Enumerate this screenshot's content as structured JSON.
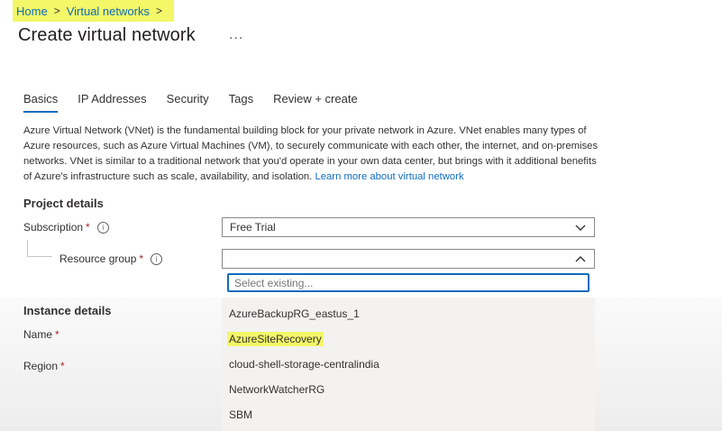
{
  "breadcrumb": {
    "home": "Home",
    "virtual_networks": "Virtual networks",
    "sep": ">"
  },
  "page": {
    "title": "Create virtual network",
    "more": "..."
  },
  "tabs": [
    {
      "label": "Basics",
      "active": true
    },
    {
      "label": "IP Addresses",
      "active": false
    },
    {
      "label": "Security",
      "active": false
    },
    {
      "label": "Tags",
      "active": false
    },
    {
      "label": "Review + create",
      "active": false
    }
  ],
  "intro": {
    "text": "Azure Virtual Network (VNet) is the fundamental building block for your private network in Azure. VNet enables many types of Azure resources, such as Azure Virtual Machines (VM), to securely communicate with each other, the internet, and on-premises networks. VNet is similar to a traditional network that you'd operate in your own data center, but brings with it additional benefits of Azure's infrastructure such as scale, availability, and isolation.",
    "link": "Learn more about virtual network"
  },
  "project_details": {
    "title": "Project details",
    "subscription_label": "Subscription",
    "subscription_value": "Free Trial",
    "resource_group_label": "Resource group",
    "resource_group_value": ""
  },
  "required_mark": "*",
  "info_glyph": "i",
  "search": {
    "placeholder": "Select existing..."
  },
  "instance_details": {
    "title": "Instance details",
    "name_label": "Name",
    "region_label": "Region"
  },
  "resource_group_options": [
    "AzureBackupRG_eastus_1",
    "AzureSiteRecovery",
    "cloud-shell-storage-centralindia",
    "NetworkWatcherRG",
    "SBM"
  ],
  "colors": {
    "highlight": "#f3f768",
    "link": "#0f6cbd",
    "required": "#a4262c"
  },
  "icons": [
    "chevron-right-icon",
    "more-icon",
    "info-icon",
    "chevron-down-icon",
    "chevron-up-icon"
  ]
}
